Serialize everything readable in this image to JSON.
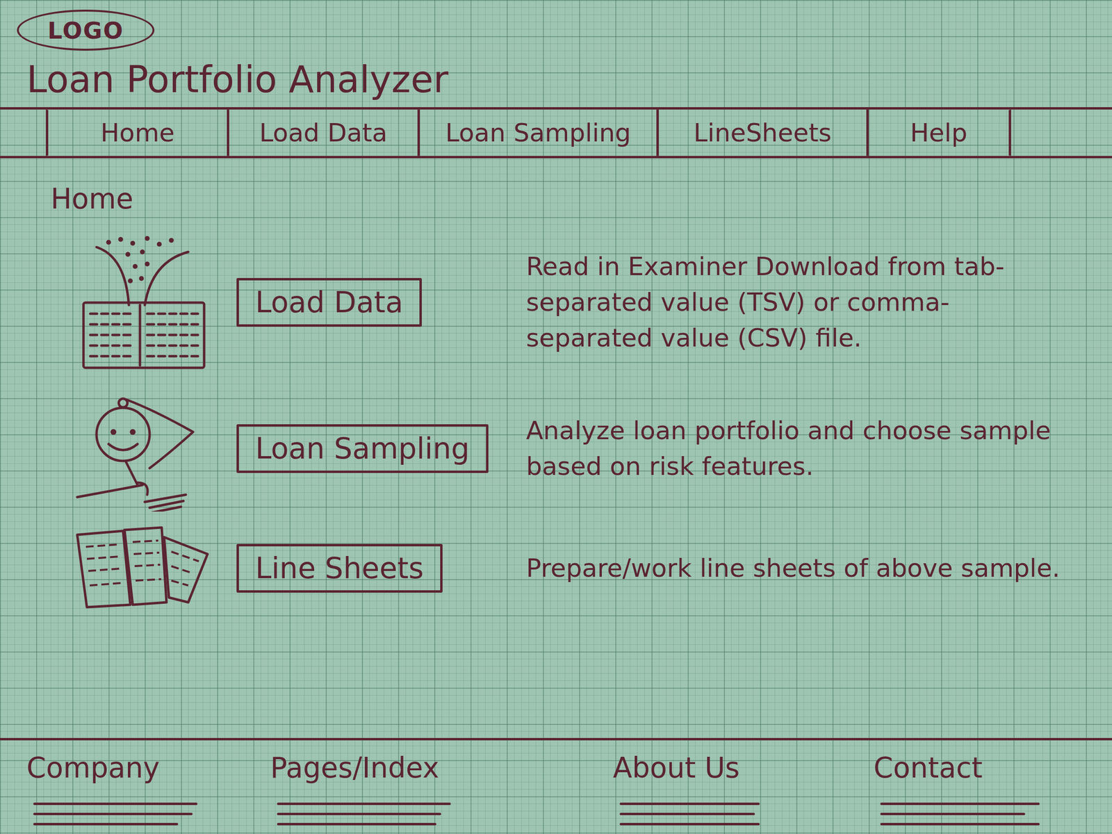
{
  "logo": "LOGO",
  "title": "Loan Portfolio Analyzer",
  "nav": [
    {
      "label": "Home"
    },
    {
      "label": "Load Data"
    },
    {
      "label": "Loan Sampling"
    },
    {
      "label": "LineSheets"
    },
    {
      "label": "Help"
    }
  ],
  "page_heading": "Home",
  "features": [
    {
      "button": "Load Data",
      "description": "Read in Examiner Download from tab-separated value (TSV) or comma-separated value (CSV) file."
    },
    {
      "button": "Loan Sampling",
      "description": "Analyze loan portfolio and choose sample based on risk features."
    },
    {
      "button": "Line Sheets",
      "description": "Prepare/work line sheets of above sample."
    }
  ],
  "footer": [
    "Company",
    "Pages/Index",
    "About Us",
    "Contact"
  ]
}
